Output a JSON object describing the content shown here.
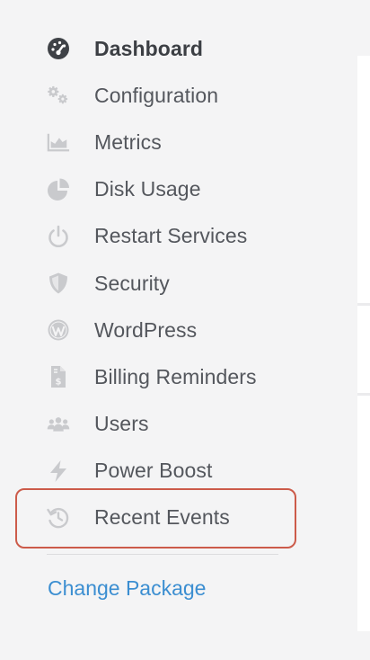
{
  "sidebar": {
    "items": [
      {
        "label": "Dashboard",
        "icon": "dashboard-gauge-icon",
        "active": true
      },
      {
        "label": "Configuration",
        "icon": "gears-icon"
      },
      {
        "label": "Metrics",
        "icon": "area-chart-icon"
      },
      {
        "label": "Disk Usage",
        "icon": "pie-chart-icon"
      },
      {
        "label": "Restart Services",
        "icon": "power-icon"
      },
      {
        "label": "Security",
        "icon": "shield-icon"
      },
      {
        "label": "WordPress",
        "icon": "wordpress-icon"
      },
      {
        "label": "Billing Reminders",
        "icon": "invoice-dollar-icon"
      },
      {
        "label": "Users",
        "icon": "users-icon"
      },
      {
        "label": "Power Boost",
        "icon": "lightning-bolt-icon"
      },
      {
        "label": "Recent Events",
        "icon": "history-icon",
        "highlighted": true
      }
    ],
    "footer_link": "Change Package"
  },
  "colors": {
    "active_icon": "#3f4247",
    "inactive_icon": "#c9cacd",
    "label": "#54575d",
    "link": "#3b8ed1",
    "highlight_border": "#cc5b4a",
    "background": "#f4f4f5"
  }
}
